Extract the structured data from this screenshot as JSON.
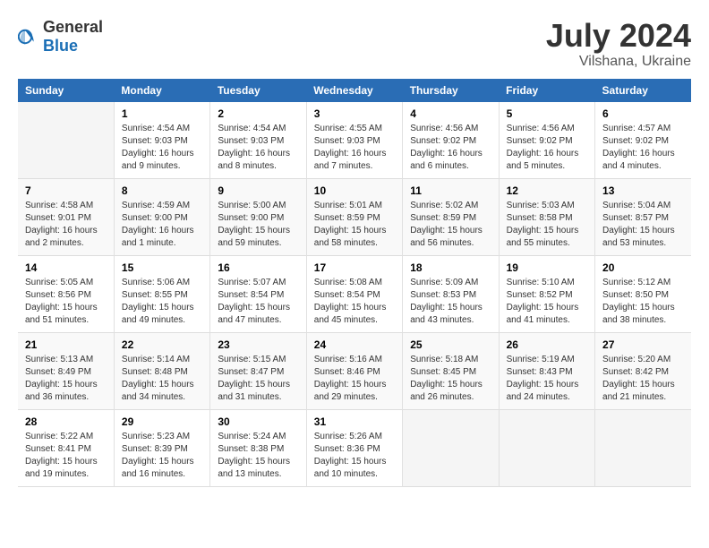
{
  "header": {
    "logo_general": "General",
    "logo_blue": "Blue",
    "month": "July 2024",
    "location": "Vilshana, Ukraine"
  },
  "weekdays": [
    "Sunday",
    "Monday",
    "Tuesday",
    "Wednesday",
    "Thursday",
    "Friday",
    "Saturday"
  ],
  "weeks": [
    [
      {
        "day": "",
        "empty": true
      },
      {
        "day": "1",
        "sunrise": "4:54 AM",
        "sunset": "9:03 PM",
        "daylight": "16 hours and 9 minutes."
      },
      {
        "day": "2",
        "sunrise": "4:54 AM",
        "sunset": "9:03 PM",
        "daylight": "16 hours and 8 minutes."
      },
      {
        "day": "3",
        "sunrise": "4:55 AM",
        "sunset": "9:03 PM",
        "daylight": "16 hours and 7 minutes."
      },
      {
        "day": "4",
        "sunrise": "4:56 AM",
        "sunset": "9:02 PM",
        "daylight": "16 hours and 6 minutes."
      },
      {
        "day": "5",
        "sunrise": "4:56 AM",
        "sunset": "9:02 PM",
        "daylight": "16 hours and 5 minutes."
      },
      {
        "day": "6",
        "sunrise": "4:57 AM",
        "sunset": "9:02 PM",
        "daylight": "16 hours and 4 minutes."
      }
    ],
    [
      {
        "day": "7",
        "sunrise": "4:58 AM",
        "sunset": "9:01 PM",
        "daylight": "16 hours and 2 minutes."
      },
      {
        "day": "8",
        "sunrise": "4:59 AM",
        "sunset": "9:00 PM",
        "daylight": "16 hours and 1 minute."
      },
      {
        "day": "9",
        "sunrise": "5:00 AM",
        "sunset": "9:00 PM",
        "daylight": "15 hours and 59 minutes."
      },
      {
        "day": "10",
        "sunrise": "5:01 AM",
        "sunset": "8:59 PM",
        "daylight": "15 hours and 58 minutes."
      },
      {
        "day": "11",
        "sunrise": "5:02 AM",
        "sunset": "8:59 PM",
        "daylight": "15 hours and 56 minutes."
      },
      {
        "day": "12",
        "sunrise": "5:03 AM",
        "sunset": "8:58 PM",
        "daylight": "15 hours and 55 minutes."
      },
      {
        "day": "13",
        "sunrise": "5:04 AM",
        "sunset": "8:57 PM",
        "daylight": "15 hours and 53 minutes."
      }
    ],
    [
      {
        "day": "14",
        "sunrise": "5:05 AM",
        "sunset": "8:56 PM",
        "daylight": "15 hours and 51 minutes."
      },
      {
        "day": "15",
        "sunrise": "5:06 AM",
        "sunset": "8:55 PM",
        "daylight": "15 hours and 49 minutes."
      },
      {
        "day": "16",
        "sunrise": "5:07 AM",
        "sunset": "8:54 PM",
        "daylight": "15 hours and 47 minutes."
      },
      {
        "day": "17",
        "sunrise": "5:08 AM",
        "sunset": "8:54 PM",
        "daylight": "15 hours and 45 minutes."
      },
      {
        "day": "18",
        "sunrise": "5:09 AM",
        "sunset": "8:53 PM",
        "daylight": "15 hours and 43 minutes."
      },
      {
        "day": "19",
        "sunrise": "5:10 AM",
        "sunset": "8:52 PM",
        "daylight": "15 hours and 41 minutes."
      },
      {
        "day": "20",
        "sunrise": "5:12 AM",
        "sunset": "8:50 PM",
        "daylight": "15 hours and 38 minutes."
      }
    ],
    [
      {
        "day": "21",
        "sunrise": "5:13 AM",
        "sunset": "8:49 PM",
        "daylight": "15 hours and 36 minutes."
      },
      {
        "day": "22",
        "sunrise": "5:14 AM",
        "sunset": "8:48 PM",
        "daylight": "15 hours and 34 minutes."
      },
      {
        "day": "23",
        "sunrise": "5:15 AM",
        "sunset": "8:47 PM",
        "daylight": "15 hours and 31 minutes."
      },
      {
        "day": "24",
        "sunrise": "5:16 AM",
        "sunset": "8:46 PM",
        "daylight": "15 hours and 29 minutes."
      },
      {
        "day": "25",
        "sunrise": "5:18 AM",
        "sunset": "8:45 PM",
        "daylight": "15 hours and 26 minutes."
      },
      {
        "day": "26",
        "sunrise": "5:19 AM",
        "sunset": "8:43 PM",
        "daylight": "15 hours and 24 minutes."
      },
      {
        "day": "27",
        "sunrise": "5:20 AM",
        "sunset": "8:42 PM",
        "daylight": "15 hours and 21 minutes."
      }
    ],
    [
      {
        "day": "28",
        "sunrise": "5:22 AM",
        "sunset": "8:41 PM",
        "daylight": "15 hours and 19 minutes."
      },
      {
        "day": "29",
        "sunrise": "5:23 AM",
        "sunset": "8:39 PM",
        "daylight": "15 hours and 16 minutes."
      },
      {
        "day": "30",
        "sunrise": "5:24 AM",
        "sunset": "8:38 PM",
        "daylight": "15 hours and 13 minutes."
      },
      {
        "day": "31",
        "sunrise": "5:26 AM",
        "sunset": "8:36 PM",
        "daylight": "15 hours and 10 minutes."
      },
      {
        "day": "",
        "empty": true
      },
      {
        "day": "",
        "empty": true
      },
      {
        "day": "",
        "empty": true
      }
    ]
  ]
}
